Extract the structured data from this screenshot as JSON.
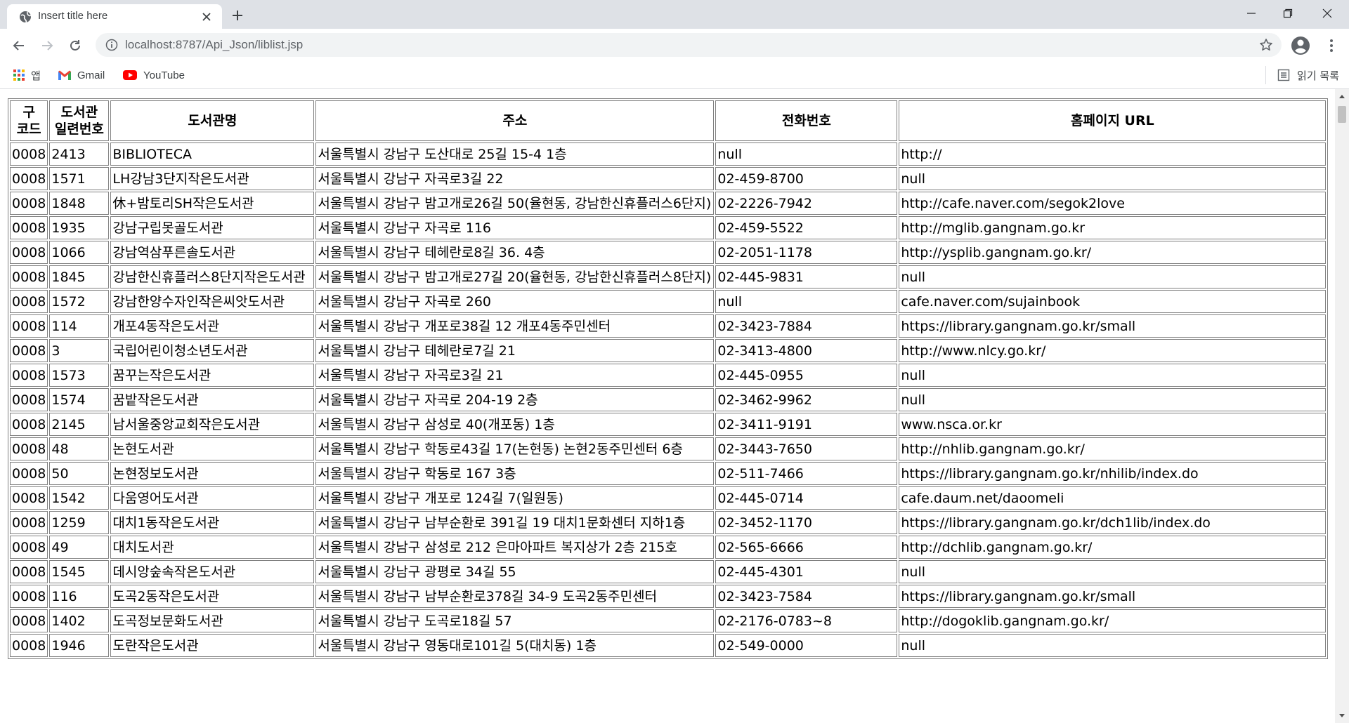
{
  "browser": {
    "tab_title": "Insert title here",
    "url": "localhost:8787/Api_Json/liblist.jsp",
    "bookmarks": [
      {
        "label": "앱",
        "icon": "apps-grid-icon"
      },
      {
        "label": "Gmail",
        "icon": "gmail-icon"
      },
      {
        "label": "YouTube",
        "icon": "youtube-icon"
      }
    ],
    "reading_list": "읽기 목록"
  },
  "table": {
    "headers": [
      "구\n코드",
      "도서관\n일련번호",
      "도서관명",
      "주소",
      "전화번호",
      "홈페이지 URL"
    ],
    "rows": [
      [
        "0008",
        "2413",
        "BIBLIOTECA",
        "서울특별시 강남구 도산대로 25길 15-4 1층",
        "null",
        "http://"
      ],
      [
        "0008",
        "1571",
        "LH강남3단지작은도서관",
        "서울특별시 강남구 자곡로3길 22",
        "02-459-8700",
        "null"
      ],
      [
        "0008",
        "1848",
        "休+밤토리SH작은도서관",
        "서울특별시 강남구 밤고개로26길 50(율현동, 강남한신휴플러스6단지)",
        "02-2226-7942",
        "http://cafe.naver.com/segok2love"
      ],
      [
        "0008",
        "1935",
        "강남구립못골도서관",
        "서울특별시 강남구 자곡로 116",
        "02-459-5522",
        "http://mglib.gangnam.go.kr"
      ],
      [
        "0008",
        "1066",
        "강남역삼푸른솔도서관",
        "서울특별시 강남구 테헤란로8길 36. 4층",
        "02-2051-1178",
        "http://ysplib.gangnam.go.kr/"
      ],
      [
        "0008",
        "1845",
        "강남한신휴플러스8단지작은도서관",
        "서울특별시 강남구 밤고개로27길 20(율현동, 강남한신휴플러스8단지)",
        "02-445-9831",
        "null"
      ],
      [
        "0008",
        "1572",
        "강남한양수자인작은씨앗도서관",
        "서울특별시 강남구 자곡로 260",
        "null",
        "cafe.naver.com/sujainbook"
      ],
      [
        "0008",
        "114",
        "개포4동작은도서관",
        "서울특별시 강남구 개포로38길 12 개포4동주민센터",
        "02-3423-7884",
        "https://library.gangnam.go.kr/small"
      ],
      [
        "0008",
        "3",
        "국립어린이청소년도서관",
        "서울특별시 강남구 테헤란로7길 21",
        "02-3413-4800",
        "http://www.nlcy.go.kr/"
      ],
      [
        "0008",
        "1573",
        "꿈꾸는작은도서관",
        "서울특별시 강남구 자곡로3길 21",
        "02-445-0955",
        "null"
      ],
      [
        "0008",
        "1574",
        "꿈밭작은도서관",
        "서울특별시 강남구 자곡로 204-19 2층",
        "02-3462-9962",
        "null"
      ],
      [
        "0008",
        "2145",
        "남서울중앙교회작은도서관",
        "서울특별시 강남구 삼성로 40(개포동) 1층",
        "02-3411-9191",
        "www.nsca.or.kr"
      ],
      [
        "0008",
        "48",
        "논현도서관",
        "서울특별시 강남구 학동로43길 17(논현동) 논현2동주민센터 6층",
        "02-3443-7650",
        "http://nhlib.gangnam.go.kr/"
      ],
      [
        "0008",
        "50",
        "논현정보도서관",
        "서울특별시 강남구 학동로 167 3층",
        "02-511-7466",
        "https://library.gangnam.go.kr/nhilib/index.do"
      ],
      [
        "0008",
        "1542",
        "다움영어도서관",
        "서울특별시 강남구 개포로 124길 7(일원동)",
        "02-445-0714",
        "cafe.daum.net/daoomeli"
      ],
      [
        "0008",
        "1259",
        "대치1동작은도서관",
        "서울특별시 강남구 남부순환로 391길 19 대치1문화센터 지하1층",
        "02-3452-1170",
        "https://library.gangnam.go.kr/dch1lib/index.do"
      ],
      [
        "0008",
        "49",
        "대치도서관",
        "서울특별시 강남구 삼성로 212 은마아파트 복지상가 2층 215호",
        "02-565-6666",
        "http://dchlib.gangnam.go.kr/"
      ],
      [
        "0008",
        "1545",
        "데시앙숲속작은도서관",
        "서울특별시 강남구 광평로 34길 55",
        "02-445-4301",
        "null"
      ],
      [
        "0008",
        "116",
        "도곡2동작은도서관",
        "서울특별시 강남구 남부순환로378길 34-9 도곡2동주민센터",
        "02-3423-7584",
        "https://library.gangnam.go.kr/small"
      ],
      [
        "0008",
        "1402",
        "도곡정보문화도서관",
        "서울특별시 강남구 도곡로18길 57",
        "02-2176-0783~8",
        "http://dogoklib.gangnam.go.kr/"
      ],
      [
        "0008",
        "1946",
        "도란작은도서관",
        "서울특별시 강남구 영동대로101길 5(대치동) 1층",
        "02-549-0000",
        "null"
      ]
    ]
  }
}
